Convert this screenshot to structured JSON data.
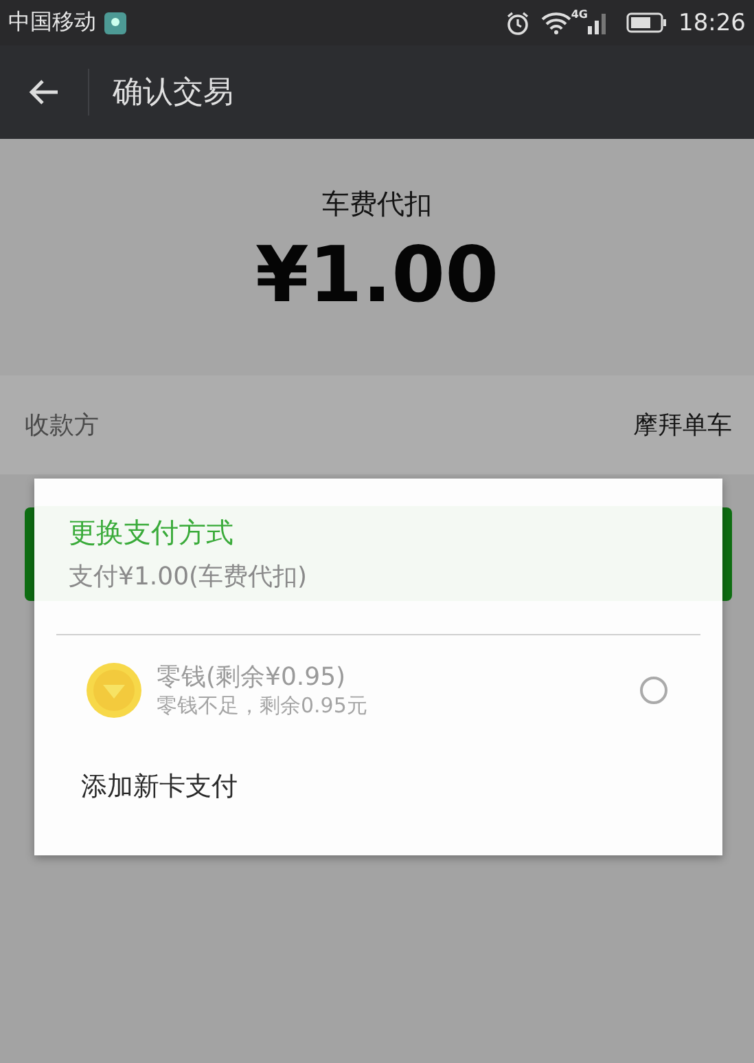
{
  "status_bar": {
    "carrier": "中国移动",
    "time": "18:26",
    "network": "4G"
  },
  "app_bar": {
    "title": "确认交易"
  },
  "summary": {
    "label": "车费代扣",
    "amount": "¥1.00"
  },
  "payee": {
    "label": "收款方",
    "value": "摩拜单车"
  },
  "dialog": {
    "title": "更换支付方式",
    "subtitle": "支付¥1.00(车费代扣)",
    "options": [
      {
        "kind": "balance",
        "name": "零钱(剩余¥0.95)",
        "note": "零钱不足，剩余0.95元",
        "disabled": true,
        "selected": false
      },
      {
        "kind": "action",
        "name": "添加新卡支付"
      }
    ]
  }
}
